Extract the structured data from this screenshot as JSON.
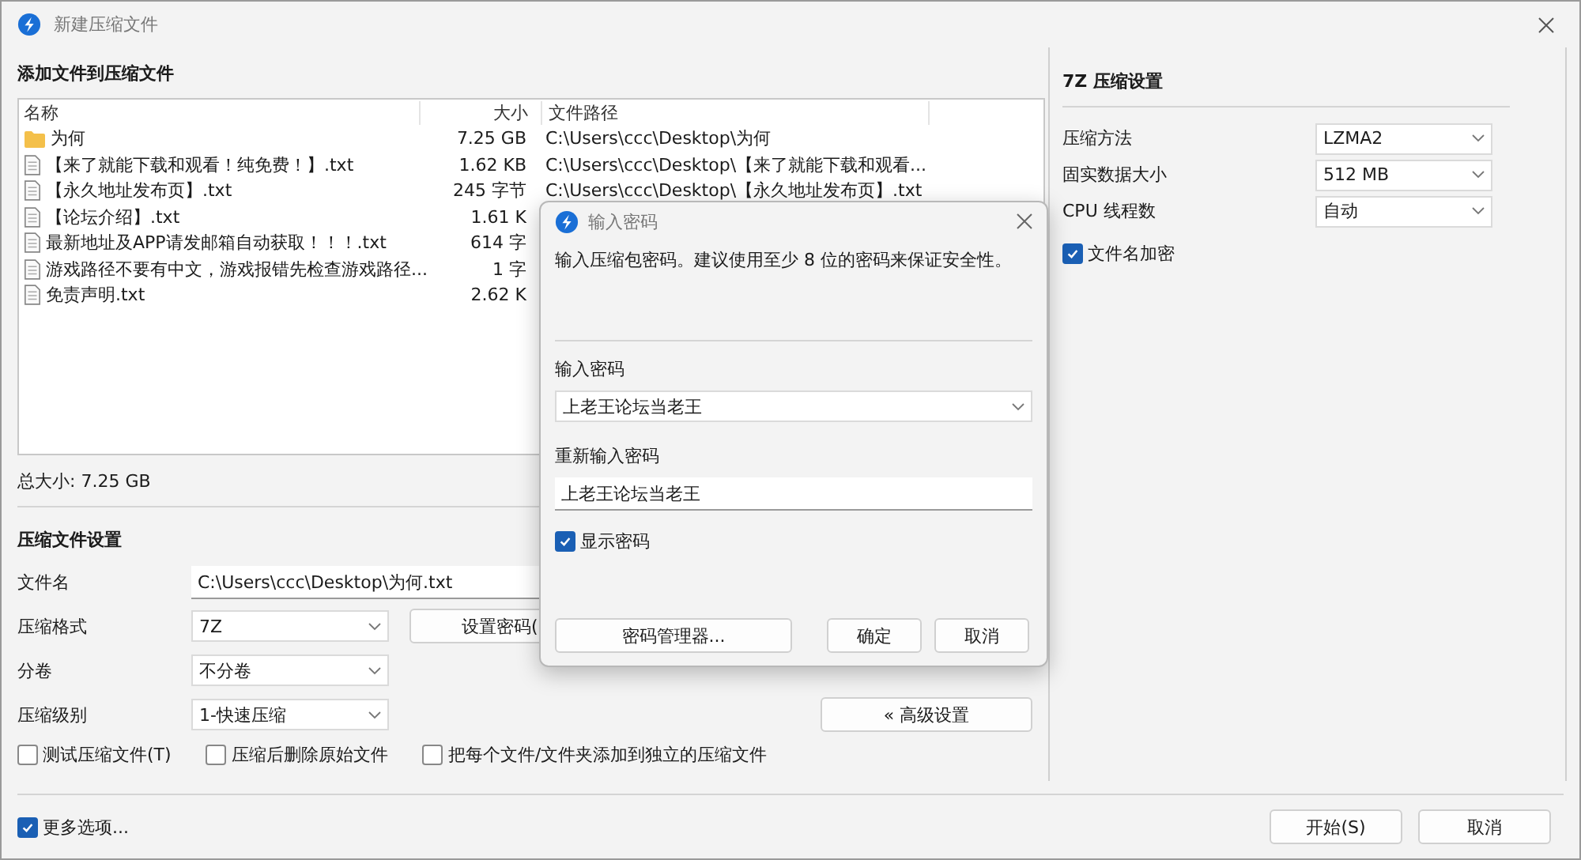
{
  "window": {
    "title": "新建压缩文件"
  },
  "files": {
    "heading": "添加文件到压缩文件",
    "columns": [
      "名称",
      "大小",
      "文件路径"
    ],
    "rows": [
      {
        "kind": "folder",
        "name": "为何",
        "size": "7.25 GB",
        "path": "C:\\Users\\ccc\\Desktop\\为何"
      },
      {
        "kind": "file",
        "name": "【来了就能下载和观看！纯免费！】.txt",
        "size": "1.62 KB",
        "path": "C:\\Users\\ccc\\Desktop\\【来了就能下载和观看..."
      },
      {
        "kind": "file",
        "name": "【永久地址发布页】.txt",
        "size": "245 字节",
        "path": "C:\\Users\\ccc\\Desktop\\【永久地址发布页】.txt"
      },
      {
        "kind": "file",
        "name": "【论坛介绍】.txt",
        "size": "1.61 K"
      },
      {
        "kind": "file",
        "name": "最新地址及APP请发邮箱自动获取！！！.txt",
        "size": "614 字"
      },
      {
        "kind": "file",
        "name": "游戏路径不要有中文，游戏报错先检查游戏路径...",
        "size": "1 字"
      },
      {
        "kind": "file",
        "name": "免责声明.txt",
        "size": "2.62 K"
      }
    ],
    "total": "总大小: 7.25 GB"
  },
  "settings": {
    "heading": "压缩文件设置",
    "fields": [
      {
        "kind": "input",
        "label": "文件名",
        "value": "C:\\Users\\ccc\\Desktop\\为何.txt"
      },
      {
        "kind": "select",
        "label": "压缩格式",
        "value": "7Z"
      },
      {
        "kind": "select",
        "label": "分卷",
        "value": "不分卷"
      },
      {
        "kind": "select",
        "label": "压缩级别",
        "value": "1-快速压缩"
      }
    ],
    "set_password_button": "设置密码(",
    "advanced_button": "« 高级设置",
    "options": [
      {
        "label": "测试压缩文件(T)",
        "checked": false
      },
      {
        "label": "压缩后删除原始文件",
        "checked": false
      },
      {
        "label": "把每个文件/文件夹添加到独立的压缩文件",
        "checked": false
      }
    ]
  },
  "more_options": {
    "label": "更多选项...",
    "checked": true
  },
  "buttons": [
    "开始(S)",
    "取消"
  ],
  "right_panel": {
    "heading": "7Z 压缩设置",
    "fields": [
      {
        "label": "压缩方法",
        "value": "LZMA2"
      },
      {
        "label": "固实数据大小",
        "value": "512 MB"
      },
      {
        "label": "CPU 线程数",
        "value": "自动"
      }
    ],
    "encrypt_names": {
      "label": "文件名加密",
      "checked": true
    }
  },
  "dialog": {
    "title": "输入密码",
    "message": "输入压缩包密码。建议使用至少 8 位的密码来保证安全性。",
    "password_label": "输入密码",
    "password": "上老王论坛当老王",
    "confirm_label": "重新输入密码",
    "confirm": "上老王论坛当老王",
    "show_password": {
      "label": "显示密码",
      "checked": true
    },
    "buttons": [
      "密码管理器...",
      "确定",
      "取消"
    ]
  }
}
